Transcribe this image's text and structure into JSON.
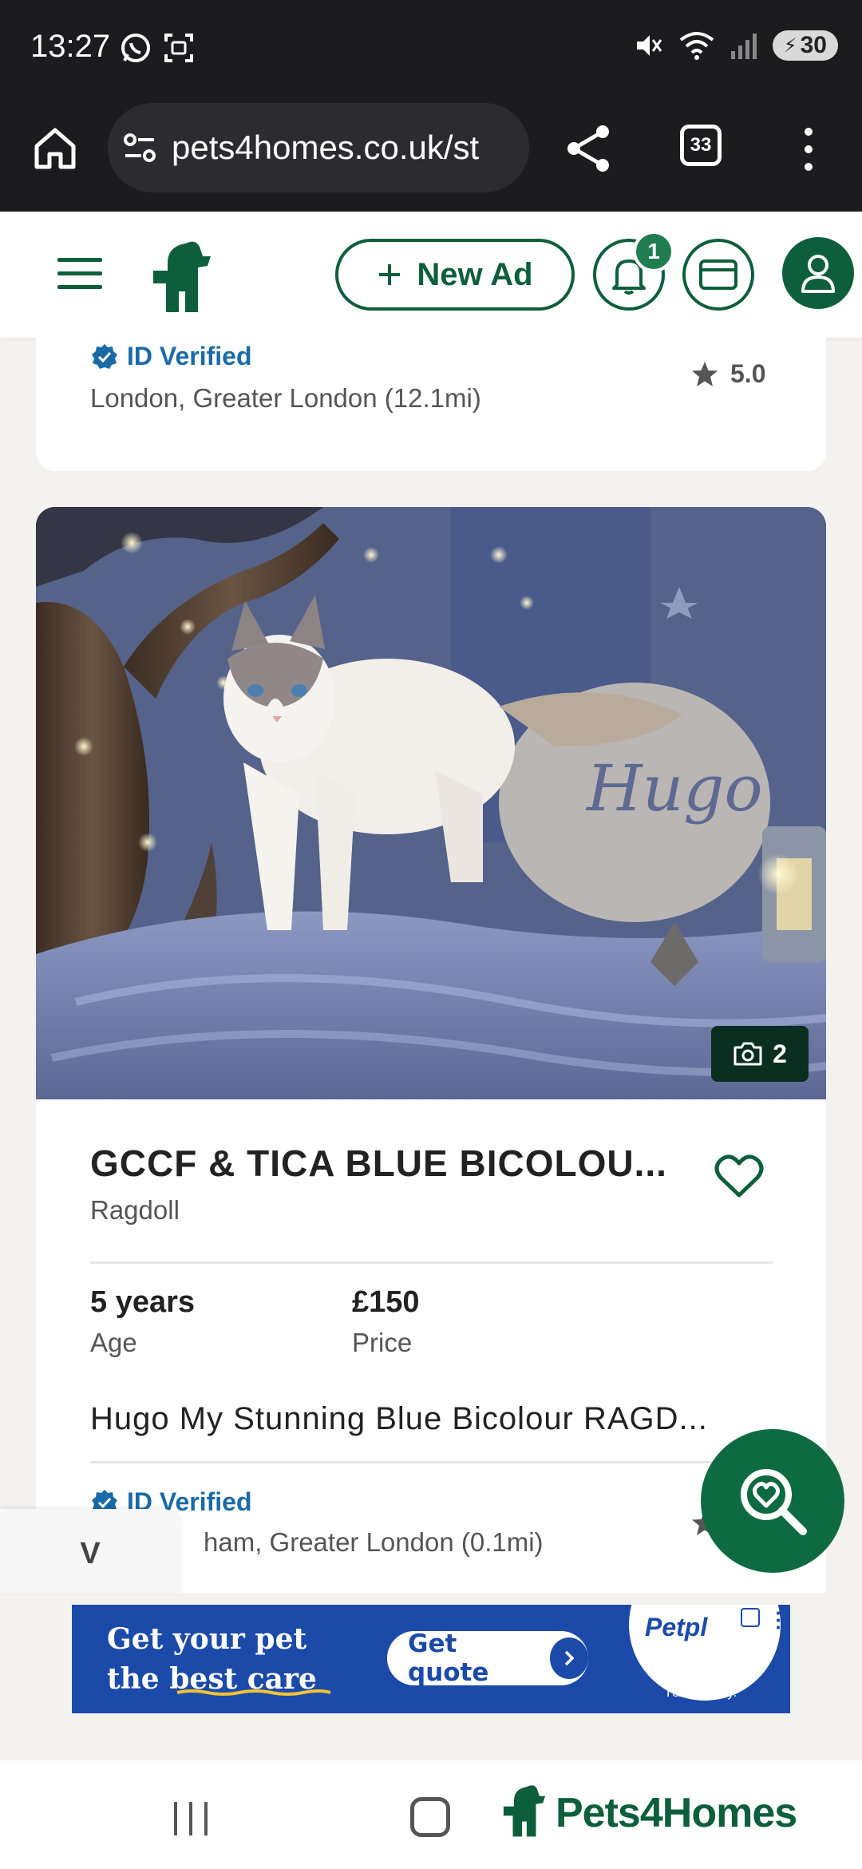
{
  "status_bar": {
    "time": "13:27",
    "battery": "30"
  },
  "browser": {
    "url": "pets4homes.co.uk/st",
    "tab_count": "33"
  },
  "header": {
    "new_ad_label": "New Ad",
    "notification_count": "1"
  },
  "previous_listing": {
    "verified_label": "ID Verified",
    "location": "London, Greater London (12.1mi)",
    "rating": "5.0"
  },
  "listing": {
    "photo_count": "2",
    "photo_name_text": "Hugo",
    "title": "GCCF & TICA BLUE BICOLOU...",
    "breed": "Ragdoll",
    "age_value": "5 years",
    "age_label": "Age",
    "price_value": "£150",
    "price_label": "Price",
    "description": "Hugo My Stunning Blue Bicolour RAGD...",
    "verified_label": "ID Verified",
    "location": "ham, Greater London (0.1mi)"
  },
  "collapse_label": "V",
  "ad": {
    "headline_line1": "Get your pet",
    "headline_line2": "the best care",
    "cta": "Get quote",
    "brand": "Petpl",
    "tcs": "T&Cs apply."
  },
  "bottom_nav": {
    "brand": "Pets4Homes"
  },
  "colors": {
    "brand_green": "#0d5f3b",
    "verified_blue": "#1a6aa6",
    "ad_blue": "#1c4aa8"
  }
}
